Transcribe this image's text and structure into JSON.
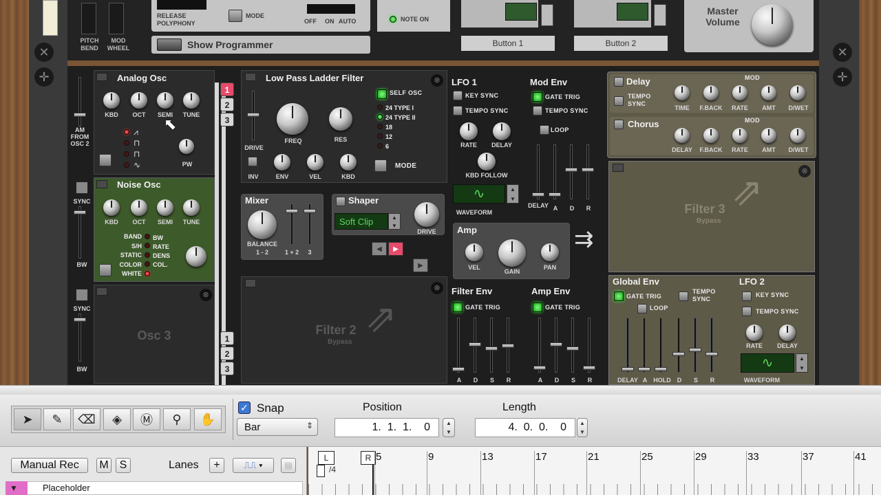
{
  "top_panel": {
    "pitch_bend": "PITCH\nBEND",
    "mod_wheel": "MOD\nWHEEL",
    "release_polyphony": "RELEASE\nPOLYPHONY",
    "mode": "MODE",
    "off": "OFF",
    "on": "ON",
    "auto": "AUTO",
    "note_on": "NOTE ON",
    "show_programmer": "Show Programmer",
    "button1": "Button 1",
    "button2": "Button 2",
    "master_volume": "Master\nVolume"
  },
  "left_strip": {
    "am_from_osc2": "AM\nFROM\nOSC 2",
    "sync1": "SYNC",
    "bw1": "BW",
    "sync2": "SYNC",
    "bw2": "BW"
  },
  "analog_osc": {
    "title": "Analog Osc",
    "knobs": [
      "KBD",
      "OCT",
      "SEMI",
      "TUNE"
    ],
    "pw": "PW"
  },
  "noise_osc": {
    "title": "Noise Osc",
    "knobs": [
      "KBD",
      "OCT",
      "SEMI",
      "TUNE"
    ],
    "modes": [
      "BAND",
      "S/H",
      "STATIC",
      "COLOR",
      "WHITE"
    ],
    "params": [
      "BW",
      "RATE",
      "DENS",
      "COL."
    ]
  },
  "osc3": {
    "title": "Osc 3"
  },
  "filter_select": [
    "1",
    "2",
    "3"
  ],
  "filter_select_bottom": [
    "1",
    "2",
    "3"
  ],
  "filter1": {
    "title": "Low Pass Ladder Filter",
    "self_osc": "SELF OSC",
    "types": [
      "24 TYPE I",
      "24 TYPE II",
      "18",
      "12",
      "6"
    ],
    "drive": "DRIVE",
    "freq": "FREQ",
    "res": "RES",
    "inv": "INV",
    "env": "ENV",
    "vel": "VEL",
    "kbd": "KBD",
    "mode": "MODE"
  },
  "filter2": {
    "title": "Filter 2",
    "bypass": "Bypass"
  },
  "mixer": {
    "title": "Mixer",
    "balance": "BALANCE",
    "b12": "1 - 2",
    "c12": "1 + 2",
    "c3": "3"
  },
  "shaper": {
    "title": "Shaper",
    "mode": "Soft Clip",
    "drive": "DRIVE"
  },
  "amp": {
    "title": "Amp",
    "vel": "VEL",
    "gain": "GAIN",
    "pan": "PAN"
  },
  "lfo1": {
    "title": "LFO 1",
    "key_sync": "KEY SYNC",
    "tempo_sync": "TEMPO SYNC",
    "rate": "RATE",
    "delay": "DELAY",
    "kbd_follow": "KBD FOLLOW",
    "waveform": "WAVEFORM"
  },
  "mod_env": {
    "title": "Mod Env",
    "gate_trig": "GATE TRIG",
    "tempo_sync": "TEMPO SYNC",
    "loop": "LOOP",
    "faders": [
      "DELAY",
      "A",
      "D",
      "R"
    ]
  },
  "filter_env": {
    "title": "Filter Env",
    "gate_trig": "GATE TRIG",
    "faders": [
      "A",
      "D",
      "S",
      "R"
    ]
  },
  "amp_env": {
    "title": "Amp Env",
    "gate_trig": "GATE TRIG",
    "faders": [
      "A",
      "D",
      "S",
      "R"
    ]
  },
  "delay_fx": {
    "title": "Delay",
    "tempo_sync": "TEMPO\nSYNC",
    "knobs": [
      "TIME",
      "F.BACK",
      "RATE",
      "AMT",
      "D/WET"
    ],
    "mod": "MOD"
  },
  "chorus_fx": {
    "title": "Chorus",
    "knobs": [
      "DELAY",
      "F.BACK",
      "RATE",
      "AMT",
      "D/WET"
    ],
    "mod": "MOD"
  },
  "filter3": {
    "title": "Filter 3",
    "bypass": "Bypass"
  },
  "global_env": {
    "title": "Global Env",
    "gate_trig": "GATE TRIG",
    "tempo_sync": "TEMPO\nSYNC",
    "loop": "LOOP",
    "faders": [
      "DELAY",
      "A",
      "HOLD",
      "D",
      "S",
      "R"
    ]
  },
  "lfo2": {
    "title": "LFO 2",
    "key_sync": "KEY SYNC",
    "tempo_sync": "TEMPO SYNC",
    "rate": "RATE",
    "delay": "DELAY",
    "waveform": "WAVEFORM"
  },
  "toolbar": {
    "snap_label": "Snap",
    "snap_value": "Bar",
    "position_label": "Position",
    "position_value": "1.  1.  1.    0",
    "length_label": "Length",
    "length_value": "4.  0.  0.    0"
  },
  "track": {
    "manual_rec": "Manual Rec",
    "m": "M",
    "s": "S",
    "lanes": "Lanes",
    "placeholder": "Placeholder"
  },
  "ruler": {
    "l": "L",
    "r": "R",
    "sig": "/4",
    "bars": [
      "5",
      "9",
      "13",
      "17",
      "21",
      "25",
      "29",
      "33",
      "37",
      "41"
    ]
  }
}
